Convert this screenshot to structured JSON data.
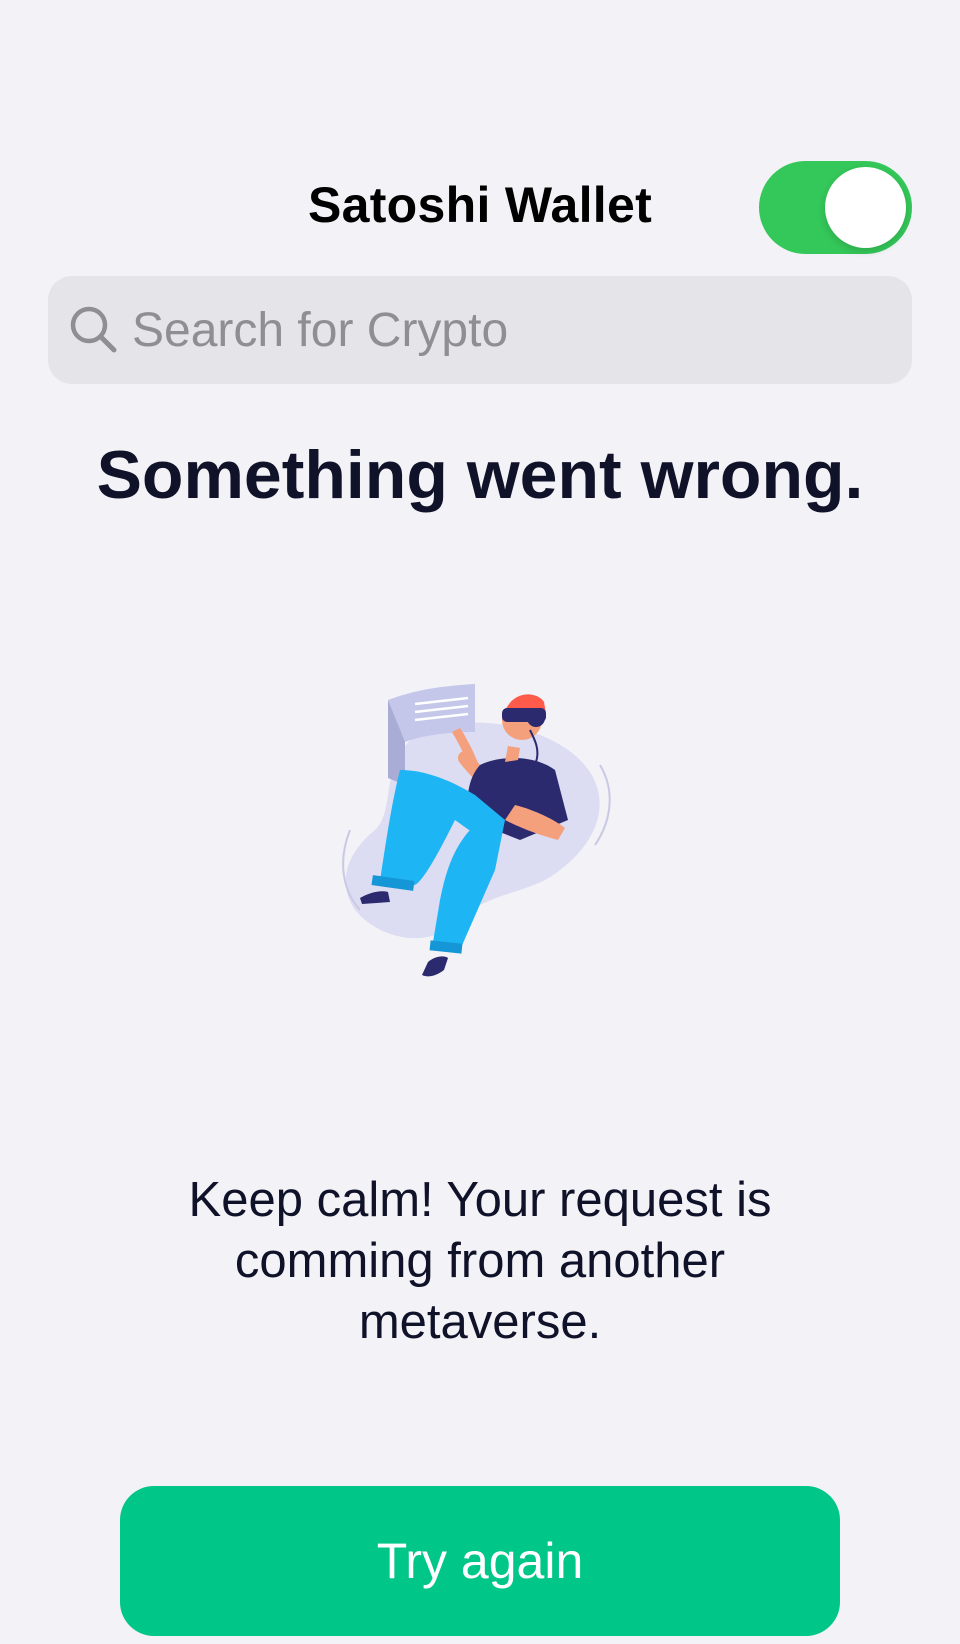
{
  "header": {
    "title": "Satoshi Wallet",
    "toggle_on": true
  },
  "search": {
    "placeholder": "Search for Crypto",
    "value": ""
  },
  "error": {
    "title": "Something went wrong.",
    "message": "Keep calm! Your request is comming from another metaverse.",
    "illustration": "vr-person-floating-illustration"
  },
  "actions": {
    "retry_label": "Try again"
  },
  "colors": {
    "background": "#f2f2f7",
    "toggle_on": "#34c759",
    "button": "#00c688",
    "title_text": "#0f1228",
    "search_bg": "#e4e4e9",
    "placeholder": "#8e8e93"
  }
}
